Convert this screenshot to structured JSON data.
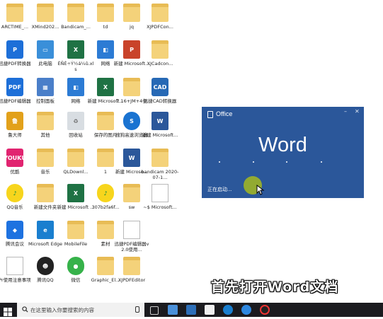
{
  "desktop_icons": [
    {
      "label": "ARCTIME_...",
      "type": "folder",
      "glyph": ""
    },
    {
      "label": "XMind202...",
      "type": "folder",
      "glyph": ""
    },
    {
      "label": "Bandicam_...",
      "type": "folder",
      "glyph": ""
    },
    {
      "label": "td",
      "type": "folder",
      "glyph": ""
    },
    {
      "label": "jq",
      "type": "folder",
      "glyph": ""
    },
    {
      "label": "XJPDFCon...",
      "type": "folder",
      "glyph": ""
    },
    {
      "label": "迅捷PDF转换器",
      "type": "pdf",
      "glyph": "P"
    },
    {
      "label": "此电脑",
      "type": "comp",
      "glyph": "▭"
    },
    {
      "label": "ÈÑÈ÷Ý½á¼û.xls",
      "type": "xls",
      "glyph": "X"
    },
    {
      "label": "网络",
      "type": "net",
      "glyph": "◧"
    },
    {
      "label": "新建 Microsoft...",
      "type": "ppt",
      "glyph": "P"
    },
    {
      "label": "XJCadcon...",
      "type": "folder",
      "glyph": ""
    },
    {
      "label": "迅捷PDF编辑器",
      "type": "pdf",
      "glyph": "PDF"
    },
    {
      "label": "控制面板",
      "type": "ctrl",
      "glyph": "▦"
    },
    {
      "label": "网络",
      "type": "net",
      "glyph": "◧"
    },
    {
      "label": "新建 Microsoft...",
      "type": "xls",
      "glyph": "X"
    },
    {
      "label": "7.16+JM+4条",
      "type": "folder",
      "glyph": ""
    },
    {
      "label": "迅捷CAD转换器",
      "type": "cad",
      "glyph": "CAD"
    },
    {
      "label": "鲁大师",
      "type": "lu",
      "glyph": "鲁"
    },
    {
      "label": "其他",
      "type": "folder",
      "glyph": ""
    },
    {
      "label": "回收站",
      "type": "bin",
      "glyph": "♻"
    },
    {
      "label": "保存的图片",
      "type": "folder",
      "glyph": ""
    },
    {
      "label": "搜狗高速浏览器",
      "type": "sogou",
      "glyph": "S"
    },
    {
      "label": "新建 Microsoft...",
      "type": "word",
      "glyph": "W"
    },
    {
      "label": "优酷",
      "type": "youku",
      "glyph": "YOUKU"
    },
    {
      "label": "音乐",
      "type": "folder",
      "glyph": ""
    },
    {
      "label": "QLDownl...",
      "type": "folder",
      "glyph": ""
    },
    {
      "label": "1",
      "type": "folder",
      "glyph": ""
    },
    {
      "label": "新建 Microso...",
      "type": "word",
      "glyph": "W"
    },
    {
      "label": "bandicam 2020-07-1...",
      "type": "folder",
      "glyph": ""
    },
    {
      "label": "QQ音乐",
      "type": "qqm",
      "glyph": "♪"
    },
    {
      "label": "新建文件夹",
      "type": "folder",
      "glyph": ""
    },
    {
      "label": "新建 Microsoft ...",
      "type": "xls",
      "glyph": "X"
    },
    {
      "label": "307b2fa6f...",
      "type": "qqm",
      "glyph": "♪"
    },
    {
      "label": "sw",
      "type": "folder",
      "glyph": ""
    },
    {
      "label": "~$ Microsoft...",
      "type": "doc",
      "glyph": ""
    },
    {
      "label": "腾讯会议",
      "type": "meeting",
      "glyph": "◆"
    },
    {
      "label": "Microsoft Edge",
      "type": "edge",
      "glyph": "e"
    },
    {
      "label": "MobileFile",
      "type": "folder",
      "glyph": ""
    },
    {
      "label": "素材",
      "type": "folder",
      "glyph": ""
    },
    {
      "label": "迅捷PDF编辑器v2.0使用...",
      "type": "doc",
      "glyph": "pdf"
    },
    {
      "label": "",
      "type": "none",
      "glyph": ""
    },
    {
      "label": "Pr使用注意事项",
      "type": "doc",
      "glyph": ""
    },
    {
      "label": "腾讯QQ",
      "type": "qq",
      "glyph": "☻"
    },
    {
      "label": "微信",
      "type": "wx",
      "glyph": "●"
    },
    {
      "label": "Graphic_El...",
      "type": "folder",
      "glyph": ""
    },
    {
      "label": "XJPDFEditor",
      "type": "folder",
      "glyph": ""
    },
    {
      "label": "",
      "type": "none",
      "glyph": ""
    }
  ],
  "office_splash": {
    "brand": "Office",
    "product": "Word",
    "status": "正在启动...",
    "minimize_glyph": "–",
    "close_glyph": "✕",
    "background": "#2b579a"
  },
  "caption": "首先打开Word文档",
  "taskbar": {
    "search_placeholder": "在这里输入你要搜索的内容"
  }
}
